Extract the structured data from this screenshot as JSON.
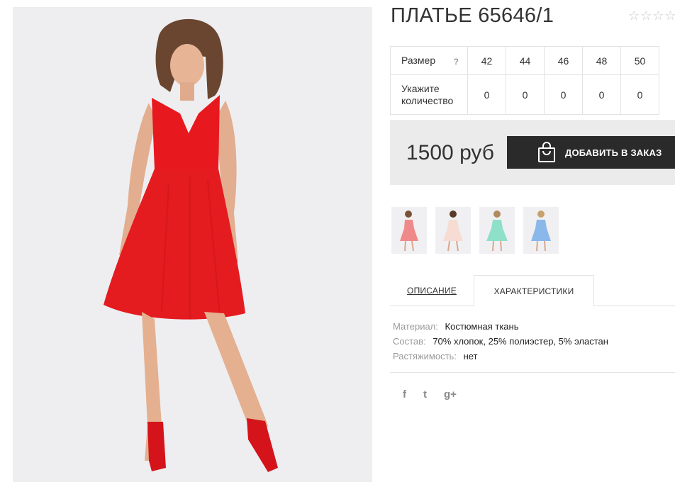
{
  "product": {
    "title": "ПЛАТЬЕ 65646/1",
    "rating": {
      "value": 0,
      "max": 5
    }
  },
  "size_table": {
    "size_label": "Размер",
    "help": "?",
    "sizes": [
      "42",
      "44",
      "46",
      "48",
      "50"
    ],
    "qty_label": "Укажите количество",
    "quantities": [
      "0",
      "0",
      "0",
      "0",
      "0"
    ]
  },
  "price": {
    "text": "1500 руб"
  },
  "order_button": {
    "label": "ДОБАВИТЬ В ЗАКАЗ",
    "icon": "shopping-bag-icon"
  },
  "thumbnails": [
    {
      "color": "#f08a8a"
    },
    {
      "color": "#f6dcd3"
    },
    {
      "color": "#8fe0c8"
    },
    {
      "color": "#8ab8ea"
    }
  ],
  "tabs": [
    {
      "label": "ОПИСАНИЕ",
      "active": false
    },
    {
      "label": "ХАРАКТЕРИСТИКИ",
      "active": true
    }
  ],
  "specs": [
    {
      "key": "Материал:",
      "value": "Костюмная ткань"
    },
    {
      "key": "Состав:",
      "value": "70% хлопок, 25% полиэстер, 5% эластан"
    },
    {
      "key": "Растяжимость:",
      "value": "нет"
    }
  ],
  "social": [
    {
      "name": "facebook-icon",
      "glyph": "f"
    },
    {
      "name": "twitter-icon",
      "glyph": "t"
    },
    {
      "name": "google-plus-icon",
      "glyph": "g+"
    }
  ],
  "colors": {
    "dress": "#e8191e",
    "button": "#2a2a2a",
    "price_bg": "#ebebeb"
  }
}
